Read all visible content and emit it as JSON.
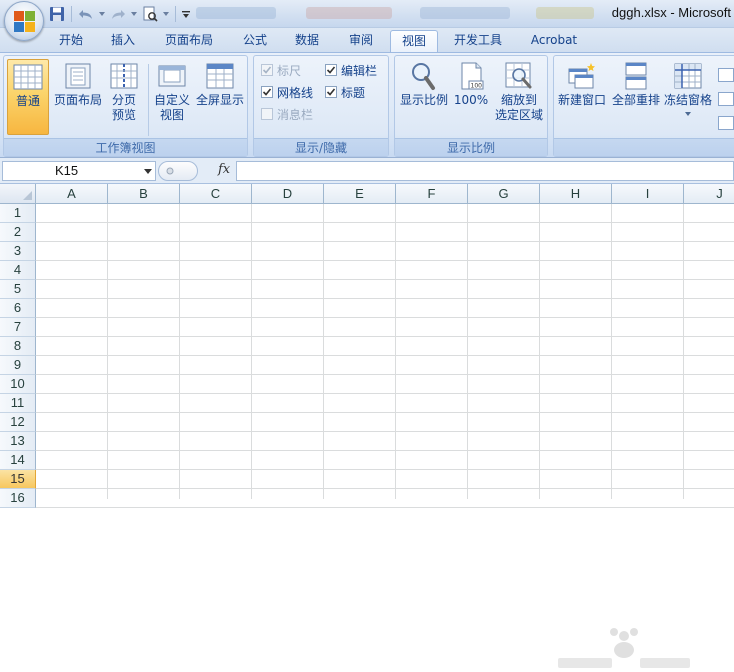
{
  "titlebar": {
    "document_title": "dggh.xlsx - Microsoft"
  },
  "tabs": [
    {
      "label": "开始"
    },
    {
      "label": "插入"
    },
    {
      "label": "页面布局"
    },
    {
      "label": "公式"
    },
    {
      "label": "数据"
    },
    {
      "label": "审阅"
    },
    {
      "label": "视图",
      "active": true
    },
    {
      "label": "开发工具"
    },
    {
      "label": "Acrobat"
    }
  ],
  "ribbon": {
    "workbook_views": {
      "label": "工作簿视图",
      "normal": "普通",
      "page_layout": "页面布局",
      "page_break_1": "分页",
      "page_break_2": "预览",
      "custom_1": "自定义",
      "custom_2": "视图",
      "full_screen": "全屏显示"
    },
    "show_hide": {
      "label": "显示/隐藏",
      "ruler": "标尺",
      "formula_bar": "编辑栏",
      "gridlines": "网格线",
      "headings": "标题",
      "message_bar": "消息栏"
    },
    "zoom": {
      "label": "显示比例",
      "zoom": "显示比例",
      "zoom100": "100%",
      "zoom_sel_1": "缩放到",
      "zoom_sel_2": "选定区域"
    },
    "window": {
      "new_window": "新建窗口",
      "arrange_all": "全部重排",
      "freeze": "冻结窗格"
    }
  },
  "formula_bar": {
    "name_box": "K15",
    "fx": "fx",
    "formula": ""
  },
  "sheet": {
    "columns": [
      "A",
      "B",
      "C",
      "D",
      "E",
      "F",
      "G",
      "H",
      "I",
      "J"
    ],
    "rows": [
      "1",
      "2",
      "3",
      "4",
      "5",
      "6",
      "7",
      "8",
      "9",
      "10",
      "11",
      "12",
      "13",
      "14",
      "15",
      "16"
    ],
    "selected_row": "15"
  },
  "icons": {
    "office_button": "office-logo-icon",
    "save": "save-icon",
    "undo": "undo-icon",
    "redo": "redo-icon",
    "print_preview": "print-preview-icon"
  }
}
